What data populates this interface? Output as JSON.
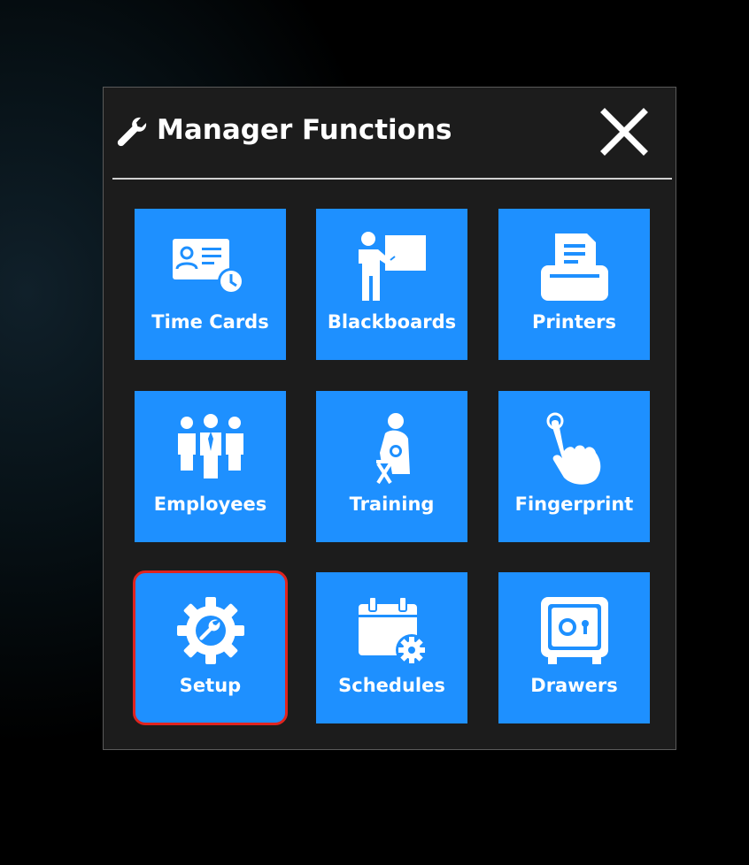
{
  "dialog": {
    "title": "Manager Functions",
    "header_icon": "wrench-icon",
    "close_icon": "close-icon"
  },
  "tiles": [
    {
      "label": "Time Cards",
      "icon": "time-card-icon"
    },
    {
      "label": "Blackboards",
      "icon": "blackboard-icon"
    },
    {
      "label": "Printers",
      "icon": "printer-icon"
    },
    {
      "label": "Employees",
      "icon": "employees-icon"
    },
    {
      "label": "Training",
      "icon": "training-icon"
    },
    {
      "label": "Fingerprint",
      "icon": "fingerprint-touch-icon"
    },
    {
      "label": "Setup",
      "icon": "setup-gear-icon",
      "selected": true
    },
    {
      "label": "Schedules",
      "icon": "schedule-calendar-icon"
    },
    {
      "label": "Drawers",
      "icon": "safe-drawer-icon"
    }
  ],
  "colors": {
    "tile_background": "#1e90ff",
    "dialog_background": "#1c1c1c",
    "selection_outline": "#e0241e",
    "text": "#ffffff"
  }
}
